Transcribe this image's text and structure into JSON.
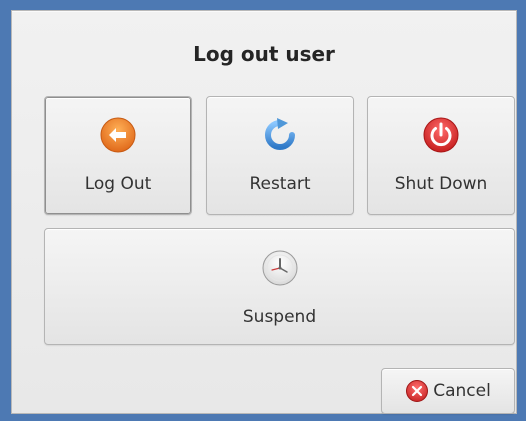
{
  "dialog": {
    "title": "Log out user",
    "actions": [
      {
        "label": "Log Out",
        "icon": "logout-arrow-icon",
        "color": "#f08024"
      },
      {
        "label": "Restart",
        "icon": "restart-icon",
        "color": "#4f97d8"
      },
      {
        "label": "Shut Down",
        "icon": "power-icon",
        "color": "#d62d2d"
      }
    ],
    "suspend": {
      "label": "Suspend",
      "icon": "clock-icon"
    },
    "cancel": {
      "label": "Cancel",
      "icon": "cancel-icon",
      "color": "#d63a3a"
    }
  }
}
